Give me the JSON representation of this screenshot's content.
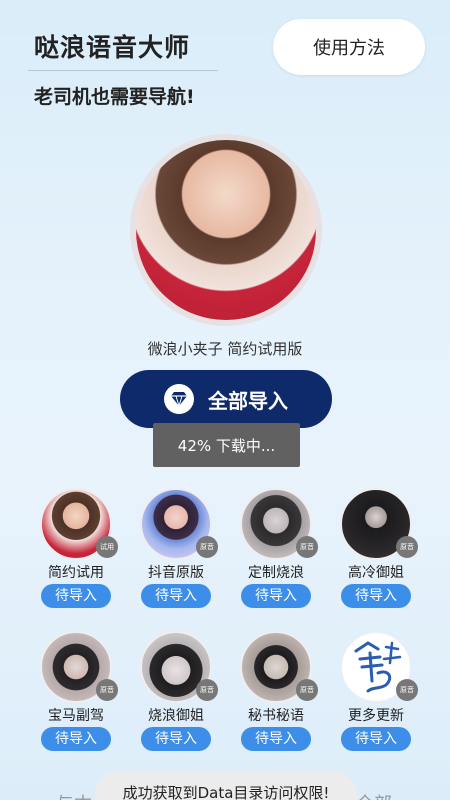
{
  "header": {
    "title": "哒浪语音大师",
    "subtitle": "老司机也需要导航!",
    "help_button": "使用方法"
  },
  "hero": {
    "voice_name": "微浪小夹子 简约试用版",
    "import_all_label": "全部导入",
    "import_icon": "diamond-icon"
  },
  "download_toast": "42% 下载中...",
  "voices": [
    {
      "label": "简约试用",
      "badge": "试用",
      "button": "待导入"
    },
    {
      "label": "抖音原版",
      "badge": "原音",
      "button": "待导入"
    },
    {
      "label": "定制烧浪",
      "badge": "原音",
      "button": "待导入"
    },
    {
      "label": "高冷御姐",
      "badge": "原音",
      "button": "待导入"
    },
    {
      "label": "宝马副驾",
      "badge": "原音",
      "button": "待导入"
    },
    {
      "label": "烧浪御姐",
      "badge": "原音",
      "button": "待导入"
    },
    {
      "label": "秘书秘语",
      "badge": "原音",
      "button": "待导入"
    },
    {
      "label": "更多更新",
      "badge": "原音",
      "button": "待导入"
    }
  ],
  "bottom_toast": "成功获取到Data目录访问权限!",
  "bottom_peek": {
    "left": "与本",
    "right": "全部"
  },
  "colors": {
    "primary_dark": "#0e2a6a",
    "button_blue": "#3d8ee8",
    "toast_gray": "#616161"
  }
}
